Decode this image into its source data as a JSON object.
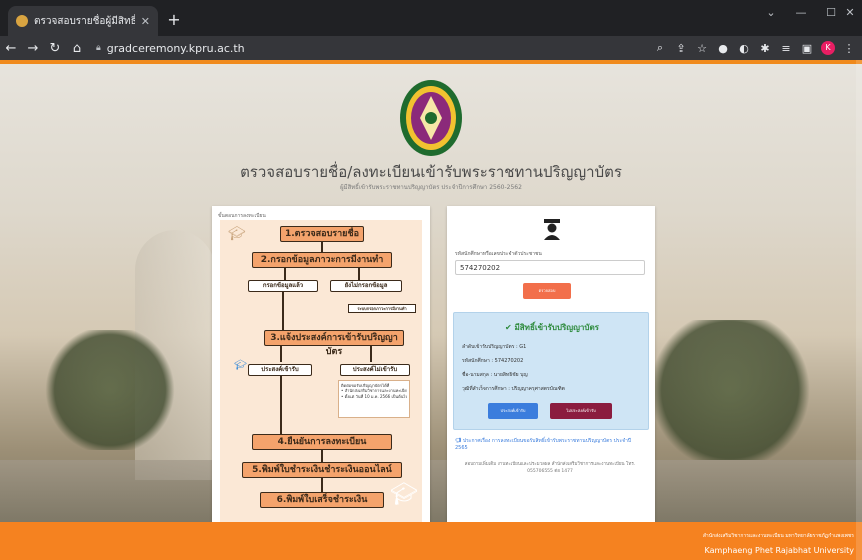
{
  "browser": {
    "tab_title": "ตรวจสอบรายชื่อผู้มีสิทธิ์เข้ารับพระ",
    "new_tab": "+",
    "url": "gradceremony.kpru.ac.th",
    "profile_initial": "K"
  },
  "page": {
    "heading": "ตรวจสอบรายชื่อ/ลงทะเบียนเข้ารับพระราชทานปริญญาบัตร",
    "subheading": "ผู้มีสิทธิ์เข้ารับพระราชทานปริญญาบัตร ประจำปีการศึกษา 2560-2562"
  },
  "flowchart": {
    "caption": "ขั้นตอนการลงทะเบียน",
    "step1": "1.ตรวจสอบรายชื่อ",
    "step2": "2.กรอกข้อมูลภาวะการมีงานทำ",
    "filled": "กรอกข้อมูลแล้ว",
    "not_filled": "ยังไม่กรอกข้อมูล",
    "system": "ระบบกรอกภาวะการมีงานทำ",
    "step3": "3.แจ้งประสงค์การเข้ารับปริญญาบัตร",
    "wish": "ประสงค์เข้ารับ",
    "no_wish": "ประสงค์ไม่เข้ารับ",
    "note_title": "ติดต่อขอรับปริญญาบัตรได้ที่",
    "note_line1": "• สำนักส่งเสริมวิชาการและงานทะเบียน อาคาร 14 ชั้น 2",
    "note_line2": "• ตั้งแต่ วันที่ 10 ม.ค. 2566 เป็นต้นไป",
    "step4": "4.ยืนยันการลงทะเบียน",
    "step5": "5.พิมพ์ใบชำระเงินชำระเงินออนไลน์",
    "step6": "6.พิมพ์ใบเสร็จชำระเงิน"
  },
  "form": {
    "id_label": "รหัสนักศึกษาหรือเลขประจำตัวประชาชน",
    "id_value": "574270202",
    "check_button": "ตรวจสอบ",
    "result_title": "มีสิทธิ์เข้ารับปริญญาบัตร",
    "result_lines": [
      "ลำดับเข้ารับปริญญาบัตร : G1",
      "รหัสนักศึกษา : 574270202",
      "ชื่อ-นามสกุล : นายสิทธิชัย บุญ",
      "วุฒิที่สำเร็จการศึกษา : ปริญญาครุศาสตรบัณฑิต"
    ],
    "wish_button": "ประสงค์เข้ารับ",
    "no_wish_button": "ไม่ประสงค์เข้ารับ",
    "announce": "ประกาศเรื่อง การลงทะเบียนขอรับสิทธิ์เข้ารับพระราชทานปริญญาบัตร ประจำปี 2565",
    "contact": "สอบถามเพิ่มเติม งานทะเบียนและประมวลผล สำนักส่งเสริมวิชาการและงานทะเบียน โทร. 055706555 ต่อ 1477"
  },
  "footer": {
    "line1": "สำนักส่งเสริมวิชาการและงานทะเบียน มหาวิทยาลัยราชภัฏกำแพงเพชร",
    "line2": "Kamphaeng Phet Rajabhat University"
  },
  "colors": {
    "accent": "#f58220",
    "success": "#2e8b3d",
    "primary_button": "#3b7ddd",
    "secondary_button": "#8b1c3f",
    "check_button": "#f26f4b"
  },
  "icons": {
    "favicon": "university-favicon",
    "back": "arrow-left-icon",
    "forward": "arrow-right-icon",
    "reload": "reload-icon",
    "home": "home-icon",
    "lock": "lock-icon",
    "zoom": "zoom-icon",
    "share": "share-icon",
    "bookmark": "star-icon",
    "graduate": "graduate-icon"
  }
}
